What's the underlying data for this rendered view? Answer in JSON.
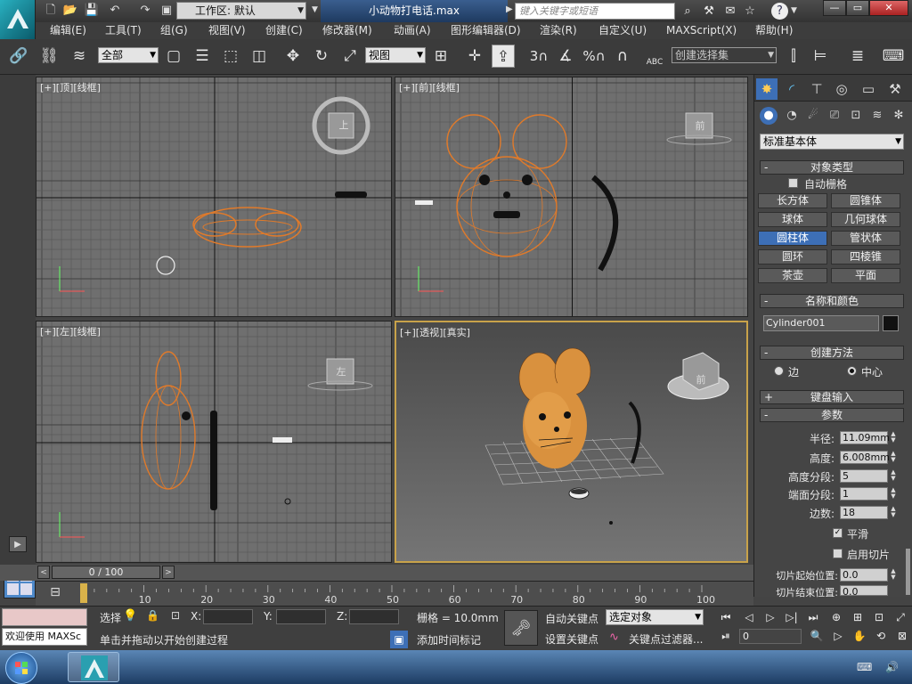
{
  "window": {
    "workspace_label": "工作区: 默认",
    "file_title": "小动物打电话.max",
    "search_placeholder": "键入关键字或短语",
    "min": "—",
    "max": "▭",
    "close": "✕"
  },
  "menus": [
    "编辑(E)",
    "工具(T)",
    "组(G)",
    "视图(V)",
    "创建(C)",
    "修改器(M)",
    "动画(A)",
    "图形编辑器(D)",
    "渲染(R)",
    "自定义(U)",
    "MAXScript(X)",
    "帮助(H)"
  ],
  "toolbar": {
    "selection_filter": "全部",
    "ref_coord": "视图",
    "named_selection": "创建选择集",
    "snap_3d": "3",
    "percent": "%",
    "abc": "ABC"
  },
  "viewports": {
    "top": {
      "label": "[+][顶][线框]",
      "cube": "上"
    },
    "front": {
      "label": "[+][前][线框]",
      "cube": "前"
    },
    "left": {
      "label": "[+][左][线框]",
      "cube": "左"
    },
    "perspective": {
      "label": "[+][透视][真实]",
      "cube": "前"
    }
  },
  "command_panel": {
    "category": "标准基本体",
    "object_type": {
      "title": "对象类型",
      "auto_grid": "自动栅格",
      "buttons": [
        "长方体",
        "圆锥体",
        "球体",
        "几何球体",
        "圆柱体",
        "管状体",
        "圆环",
        "四棱锥",
        "茶壶",
        "平面"
      ],
      "active": "圆柱体"
    },
    "name_color": {
      "title": "名称和颜色",
      "name": "Cylinder001",
      "color": "#111111"
    },
    "creation_method": {
      "title": "创建方法",
      "edge": "边",
      "center": "中心",
      "selected": "中心"
    },
    "keyboard_entry": {
      "title": "键盘输入"
    },
    "parameters": {
      "title": "参数",
      "radius_label": "半径:",
      "radius": "11.09mm",
      "height_label": "高度:",
      "height": "6.008mm",
      "height_segs_label": "高度分段:",
      "height_segs": "5",
      "cap_segs_label": "端面分段:",
      "cap_segs": "1",
      "sides_label": "边数:",
      "sides": "18",
      "smooth": "平滑",
      "slice_on": "启用切片",
      "slice_from_label": "切片起始位置:",
      "slice_from": "0.0",
      "slice_to_label": "切片结束位置:",
      "slice_to": "0.0"
    }
  },
  "timeline": {
    "frame": "0 / 100",
    "ticks": [
      "0",
      "10",
      "20",
      "30",
      "40",
      "50",
      "60",
      "70",
      "80",
      "90",
      "100"
    ]
  },
  "status": {
    "welcome": "欢迎使用 MAXSc",
    "prompt": "单击并拖动以开始创建过程",
    "select_label": "选择",
    "x_label": "X:",
    "y_label": "Y:",
    "z_label": "Z:",
    "grid": "栅格 = 10.0mm",
    "add_time_tag": "添加时间标记",
    "auto_key": "自动关键点",
    "set_key": "设置关键点",
    "key_mode": "选定对象",
    "key_filters": "关键点过滤器...",
    "current_frame": "0"
  },
  "colors": {
    "accent": "#3d6fb6",
    "wire": "#e07a2a",
    "viewport_bg": "#6f6f6f",
    "mouse_skin": "#d9913e"
  }
}
